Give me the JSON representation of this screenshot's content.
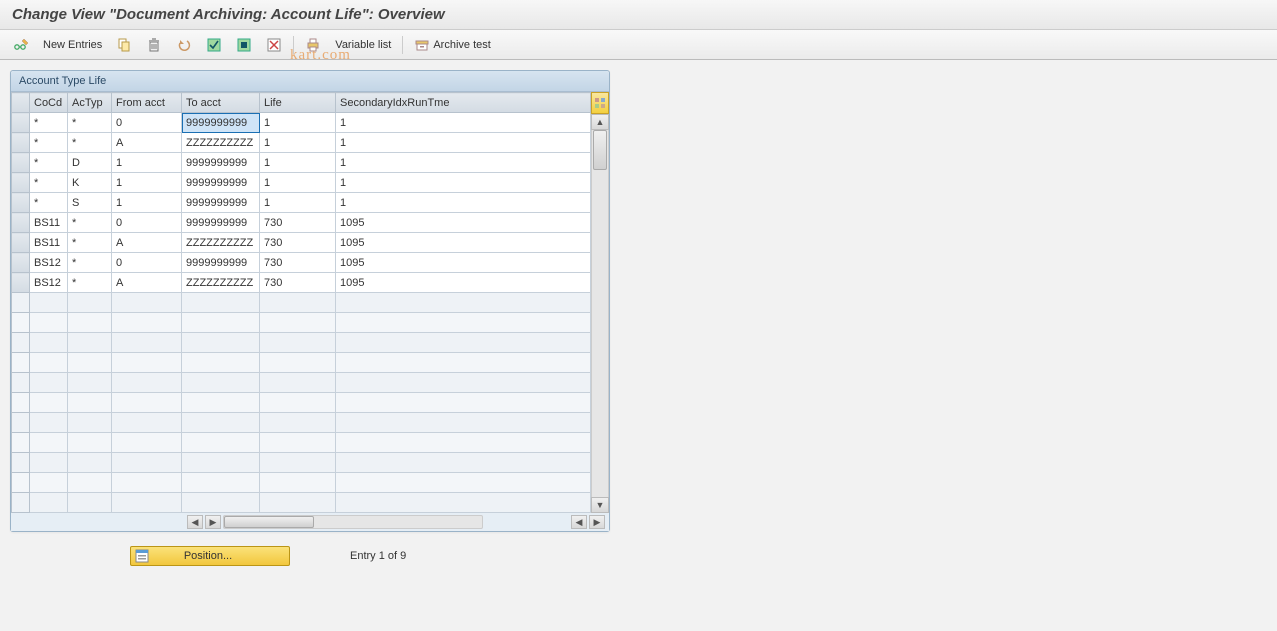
{
  "title": "Change View \"Document Archiving: Account Life\": Overview",
  "toolbar": {
    "new_entries_label": "New Entries",
    "variable_list_label": "Variable list",
    "archive_test_label": "Archive test"
  },
  "panel": {
    "header": "Account Type Life"
  },
  "columns": [
    "CoCd",
    "AcTyp",
    "From acct",
    "To acct",
    "Life",
    "SecondaryIdxRunTme"
  ],
  "rows": [
    {
      "cocd": "*",
      "actyp": "*",
      "from": "0",
      "to": "9999999999",
      "life": "1",
      "sec": "1"
    },
    {
      "cocd": "*",
      "actyp": "*",
      "from": "A",
      "to": "ZZZZZZZZZZ",
      "life": "1",
      "sec": "1"
    },
    {
      "cocd": "*",
      "actyp": "D",
      "from": "1",
      "to": "9999999999",
      "life": "1",
      "sec": "1"
    },
    {
      "cocd": "*",
      "actyp": "K",
      "from": "1",
      "to": "9999999999",
      "life": "1",
      "sec": "1"
    },
    {
      "cocd": "*",
      "actyp": "S",
      "from": "1",
      "to": "9999999999",
      "life": "1",
      "sec": "1"
    },
    {
      "cocd": "BS11",
      "actyp": "*",
      "from": "0",
      "to": "9999999999",
      "life": "730",
      "sec": "1095"
    },
    {
      "cocd": "BS11",
      "actyp": "*",
      "from": "A",
      "to": "ZZZZZZZZZZ",
      "life": "730",
      "sec": "1095"
    },
    {
      "cocd": "BS12",
      "actyp": "*",
      "from": "0",
      "to": "9999999999",
      "life": "730",
      "sec": "1095"
    },
    {
      "cocd": "BS12",
      "actyp": "*",
      "from": "A",
      "to": "ZZZZZZZZZZ",
      "life": "730",
      "sec": "1095"
    }
  ],
  "empty_row_count": 11,
  "selected_cell": {
    "row": 0,
    "col": "to"
  },
  "footer": {
    "position_label": "Position...",
    "entry_text": "Entry 1 of 9"
  },
  "watermark": "kart.com"
}
